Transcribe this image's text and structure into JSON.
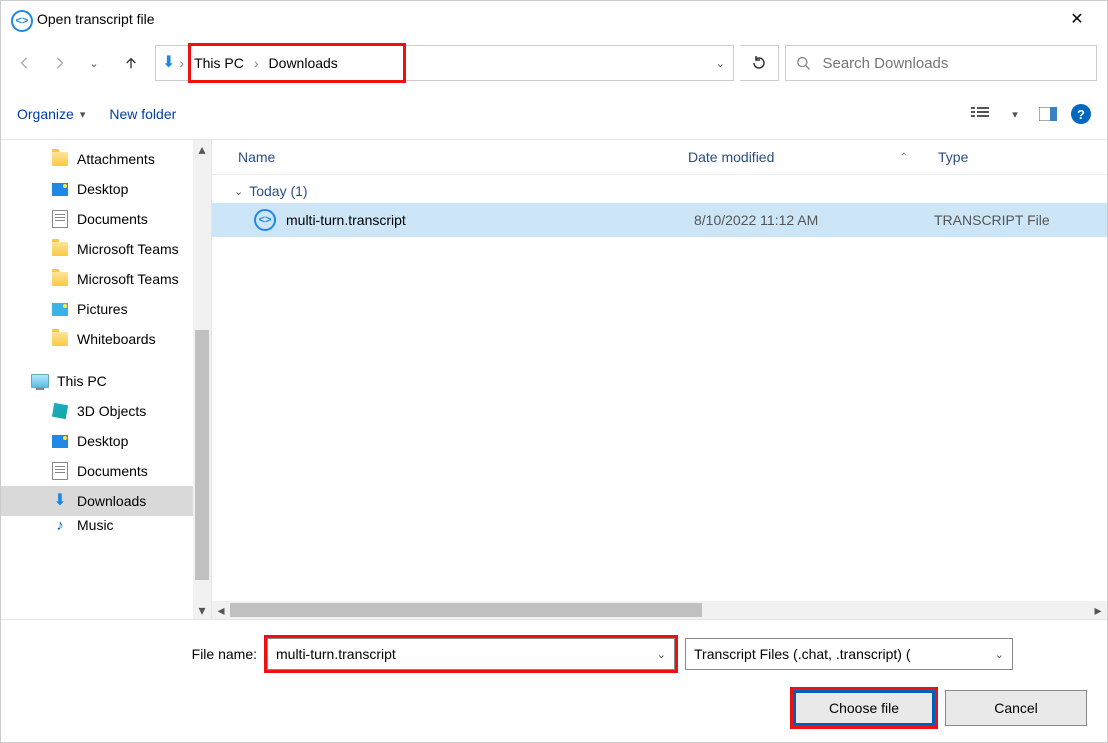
{
  "title": "Open transcript file",
  "breadcrumb": {
    "seg1": "This PC",
    "seg2": "Downloads"
  },
  "search": {
    "placeholder": "Search Downloads"
  },
  "toolbar": {
    "organize": "Organize",
    "newfolder": "New folder"
  },
  "nav": {
    "items": [
      {
        "label": "Attachments",
        "icon": "folder"
      },
      {
        "label": "Desktop",
        "icon": "desktop"
      },
      {
        "label": "Documents",
        "icon": "doc"
      },
      {
        "label": "Microsoft Teams",
        "icon": "folder"
      },
      {
        "label": "Microsoft Teams",
        "icon": "folder"
      },
      {
        "label": "Pictures",
        "icon": "pic"
      },
      {
        "label": "Whiteboards",
        "icon": "folder"
      }
    ],
    "thispc": "This PC",
    "pcitems": [
      {
        "label": "3D Objects",
        "icon": "cube"
      },
      {
        "label": "Desktop",
        "icon": "desktop"
      },
      {
        "label": "Documents",
        "icon": "doc"
      },
      {
        "label": "Downloads",
        "icon": "download",
        "selected": true
      },
      {
        "label": "Music",
        "icon": "music",
        "cut": true
      }
    ]
  },
  "columns": {
    "name": "Name",
    "date": "Date modified",
    "type": "Type"
  },
  "group": "Today (1)",
  "file": {
    "name": "multi-turn.transcript",
    "date": "8/10/2022 11:12 AM",
    "type": "TRANSCRIPT File"
  },
  "footer": {
    "fname_label": "File name:",
    "fname_value": "multi-turn.transcript",
    "filter": "Transcript Files (.chat, .transcript) (",
    "choose": "Choose file",
    "cancel": "Cancel"
  },
  "help": "?"
}
